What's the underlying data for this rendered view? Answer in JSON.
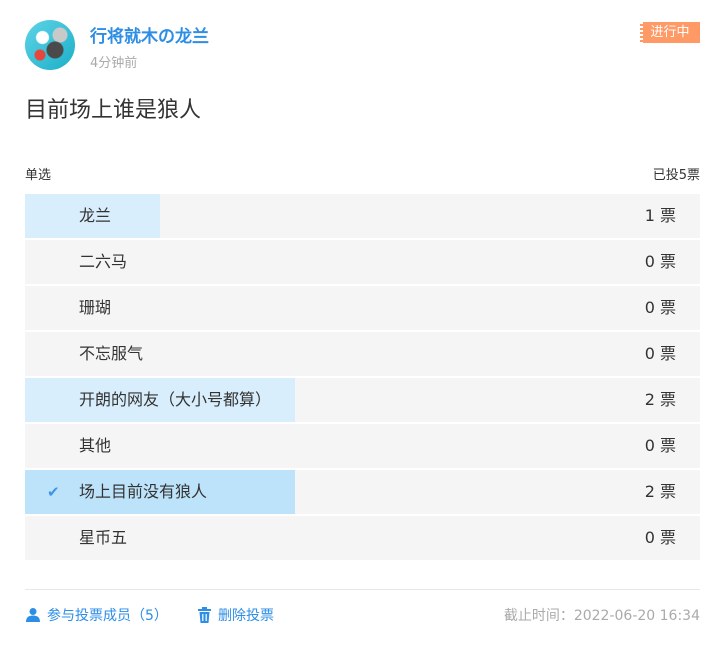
{
  "post": {
    "author": "行将就木の龙兰",
    "time": "4分钟前",
    "status": "进行中",
    "status_color": "#ff9a66",
    "question": "目前场上谁是狼人"
  },
  "poll": {
    "type_label": "单选",
    "total_label": "已投5票",
    "total_votes": 5,
    "options": [
      {
        "label": "龙兰",
        "votes_text": "1 票",
        "votes": 1,
        "selected": false
      },
      {
        "label": "二六马",
        "votes_text": "0 票",
        "votes": 0,
        "selected": false
      },
      {
        "label": "珊瑚",
        "votes_text": "0 票",
        "votes": 0,
        "selected": false
      },
      {
        "label": "不忘服气",
        "votes_text": "0 票",
        "votes": 0,
        "selected": false
      },
      {
        "label": "开朗的网友（大小号都算）",
        "votes_text": "2 票",
        "votes": 2,
        "selected": false
      },
      {
        "label": "其他",
        "votes_text": "0 票",
        "votes": 0,
        "selected": false
      },
      {
        "label": "场上目前没有狼人",
        "votes_text": "2 票",
        "votes": 2,
        "selected": true
      },
      {
        "label": "星币五",
        "votes_text": "0 票",
        "votes": 0,
        "selected": false
      }
    ],
    "check_icon": "check-icon",
    "accent_color": "#2e8ee6"
  },
  "footer": {
    "participants_label": "参与投票成员（5）",
    "participants_icon": "user-icon",
    "delete_label": "删除投票",
    "delete_icon": "trash-icon",
    "deadline": "截止时间：2022-06-20 16:34"
  }
}
